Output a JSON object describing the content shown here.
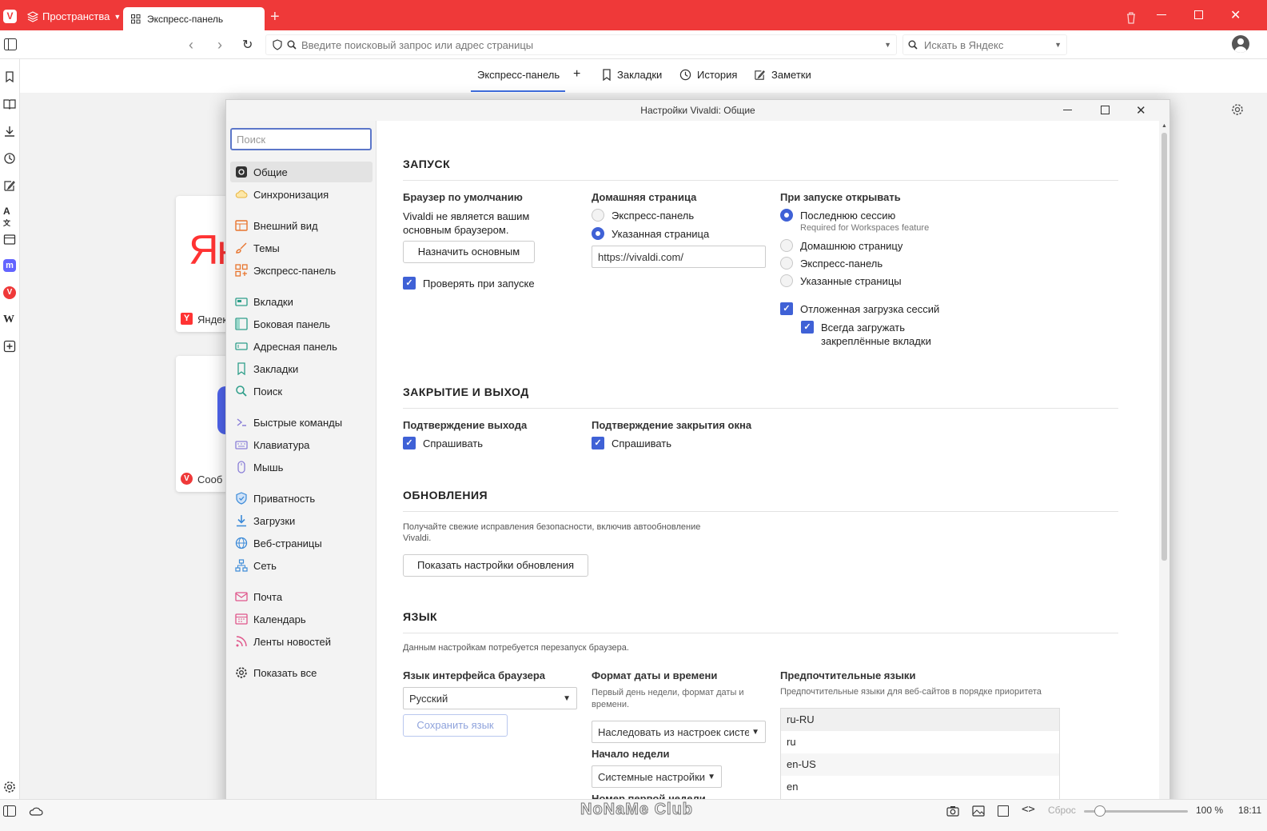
{
  "browser": {
    "spaces_label": "Пространства",
    "tab_title": "Экспресс-панель",
    "address_placeholder": "Введите поисковый запрос или адрес страницы",
    "search_placeholder": "Искать в Яндекс",
    "accent": "#ef3939"
  },
  "speed_dial": {
    "tab_express": "Экспресс-панель",
    "tab_bookmarks": "Закладки",
    "tab_history": "История",
    "tab_notes": "Заметки",
    "tile1_label": "Яндек",
    "tile1_logo": "Ян",
    "tile2_label": "Сооб"
  },
  "settings": {
    "window_title": "Настройки Vivaldi: Общие",
    "search_placeholder": "Поиск",
    "nav": [
      {
        "label": "Общие"
      },
      {
        "label": "Синхронизация"
      },
      {
        "label": "Внешний вид"
      },
      {
        "label": "Темы"
      },
      {
        "label": "Экспресс-панель"
      },
      {
        "label": "Вкладки"
      },
      {
        "label": "Боковая панель"
      },
      {
        "label": "Адресная панель"
      },
      {
        "label": "Закладки"
      },
      {
        "label": "Поиск"
      },
      {
        "label": "Быстрые команды"
      },
      {
        "label": "Клавиатура"
      },
      {
        "label": "Мышь"
      },
      {
        "label": "Приватность"
      },
      {
        "label": "Загрузки"
      },
      {
        "label": "Веб-страницы"
      },
      {
        "label": "Сеть"
      },
      {
        "label": "Почта"
      },
      {
        "label": "Календарь"
      },
      {
        "label": "Ленты новостей"
      },
      {
        "label": "Показать все"
      }
    ],
    "startup": {
      "title": "ЗАПУСК",
      "default_browser_title": "Браузер по умолчанию",
      "default_browser_text": "Vivaldi не является вашим основным браузером.",
      "set_default_button": "Назначить основным",
      "check_on_startup": "Проверять при запуске",
      "homepage_title": "Домашняя страница",
      "homepage_opt1": "Экспресс-панель",
      "homepage_opt2": "Указанная страница",
      "homepage_url": "https://vivaldi.com/",
      "open_title": "При запуске открывать",
      "open_opt1": "Последнюю сессию",
      "open_opt1_note": "Required for Workspaces feature",
      "open_opt2": "Домашнюю страницу",
      "open_opt3": "Экспресс-панель",
      "open_opt4": "Указанные страницы",
      "lazy_load": "Отложенная загрузка сессий",
      "always_load_pinned": "Всегда загружать закреплённые вкладки"
    },
    "exit": {
      "title": "ЗАКРЫТИЕ И ВЫХОД",
      "confirm_exit_title": "Подтверждение выхода",
      "confirm_exit_check": "Спрашивать",
      "confirm_close_title": "Подтверждение закрытия окна",
      "confirm_close_check": "Спрашивать"
    },
    "updates": {
      "title": "ОБНОВЛЕНИЯ",
      "text": "Получайте свежие исправления безопасности, включив автообновление Vivaldi.",
      "button": "Показать настройки обновления"
    },
    "language": {
      "title": "ЯЗЫК",
      "note": "Данным настройкам потребуется перезапуск браузера.",
      "ui_lang_title": "Язык интерфейса браузера",
      "ui_lang_value": "Русский",
      "save_button": "Сохранить язык",
      "datetime_title": "Формат даты и времени",
      "datetime_note": "Первый день недели, формат даты и времени.",
      "datetime_value": "Наследовать из настроек систем",
      "week_start_title": "Начало недели",
      "week_start_value": "Системные настройки",
      "first_week_title": "Номер первой недели",
      "preferred_title": "Предпочтительные языки",
      "preferred_note": "Предпочтительные языки для веб-сайтов в порядке приоритета",
      "preferred_list": [
        "ru-RU",
        "ru",
        "en-US",
        "en"
      ]
    }
  },
  "statusbar": {
    "reset": "Сброс",
    "zoom": "100 %",
    "time": "18:11",
    "zoom_level": 0.15
  },
  "watermark": "NoNaMe Club"
}
